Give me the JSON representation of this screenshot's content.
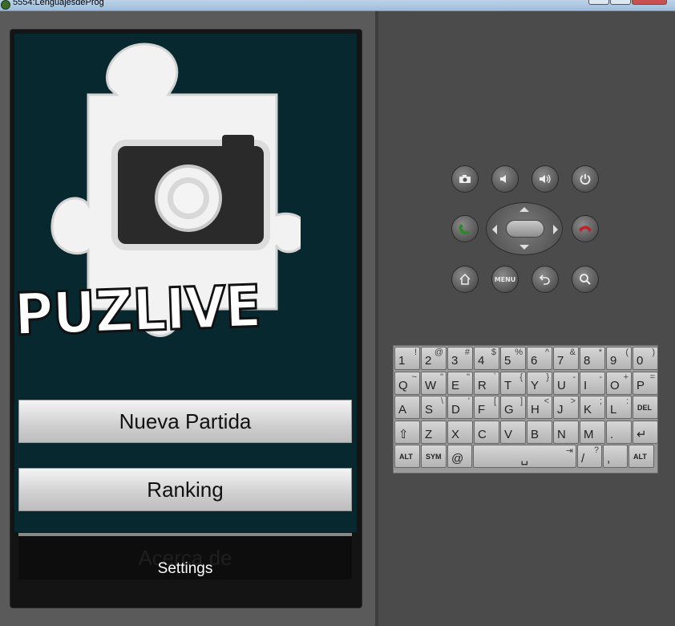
{
  "window": {
    "title": "5554:LenguajesdeProg"
  },
  "app": {
    "logo_text": "PUZLIVE",
    "buttons": {
      "new_game": "Nueva Partida",
      "ranking": "Ranking",
      "about": "Acerca de"
    },
    "settings_label": "Settings"
  },
  "controls": {
    "row1": [
      "camera-icon",
      "volume-down-icon",
      "volume-up-icon",
      "power-icon"
    ],
    "row2": [
      "call-icon",
      "dpad",
      "end-call-icon"
    ],
    "row3": [
      "home-icon",
      "menu-button",
      "back-icon",
      "search-icon"
    ],
    "menu_label": "MENU"
  },
  "keyboard": {
    "row1": [
      [
        "1",
        "!"
      ],
      [
        "2",
        "@"
      ],
      [
        "3",
        "#"
      ],
      [
        "4",
        "$"
      ],
      [
        "5",
        "%"
      ],
      [
        "6",
        "^"
      ],
      [
        "7",
        "&"
      ],
      [
        "8",
        "*"
      ],
      [
        "9",
        "("
      ],
      [
        "0",
        ")"
      ]
    ],
    "row2": [
      [
        "Q",
        "~"
      ],
      [
        "W",
        "\""
      ],
      [
        "E",
        "\""
      ],
      [
        "R",
        "`"
      ],
      [
        "T",
        "{"
      ],
      [
        "Y",
        "}"
      ],
      [
        "U",
        "-"
      ],
      [
        "I",
        "-"
      ],
      [
        "O",
        "+"
      ],
      [
        "P",
        "="
      ]
    ],
    "row3": [
      [
        "A",
        ""
      ],
      [
        "S",
        "\\"
      ],
      [
        "D",
        "'"
      ],
      [
        "F",
        "["
      ],
      [
        "G",
        "]"
      ],
      [
        "H",
        "<"
      ],
      [
        "J",
        ">"
      ],
      [
        "K",
        ";"
      ],
      [
        "L",
        ":"
      ],
      [
        "DEL",
        ""
      ]
    ],
    "row4": [
      [
        "⇧",
        ""
      ],
      [
        "Z",
        ""
      ],
      [
        "X",
        ""
      ],
      [
        "C",
        ""
      ],
      [
        "V",
        ""
      ],
      [
        "B",
        ""
      ],
      [
        "N",
        ""
      ],
      [
        "M",
        ""
      ],
      [
        ".",
        ""
      ],
      [
        "↵",
        ""
      ]
    ],
    "row5": [
      [
        "ALT",
        ""
      ],
      [
        "SYM",
        ""
      ],
      [
        "@",
        ""
      ],
      [
        "␣",
        "⇥"
      ],
      [
        "/",
        "?"
      ],
      [
        ",",
        ""
      ],
      [
        "ALT",
        ""
      ]
    ]
  },
  "colors": {
    "screen_bg": "#07282e",
    "emulator_bg": "#4b4b4b",
    "call_green": "#2a8a2a",
    "end_red": "#c0202a"
  }
}
